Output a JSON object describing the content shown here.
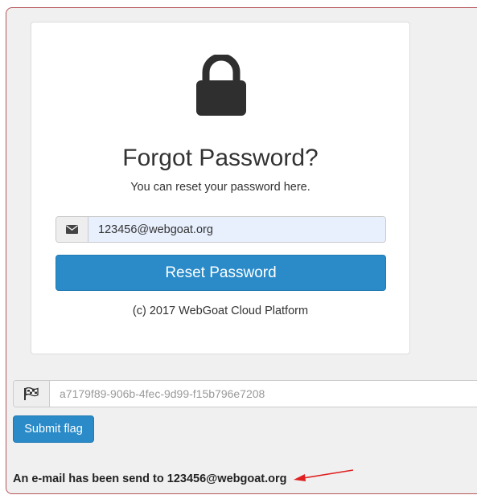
{
  "forgot": {
    "title": "Forgot Password?",
    "subtitle": "You can reset your password here.",
    "email_value": "123456@webgoat.org",
    "reset_label": "Reset Password",
    "copyright": "(c) 2017 WebGoat Cloud Platform"
  },
  "flag": {
    "placeholder": "a7179f89-906b-4fec-9d99-f15b796e7208",
    "submit_label": "Submit flag"
  },
  "result_message": "An e-mail has been send to 123456@webgoat.org",
  "colors": {
    "primary": "#2a8bc8",
    "frame_border": "#b5555a",
    "annotation_arrow": "#e02020"
  },
  "icons": [
    "lock-icon",
    "envelope-icon",
    "flag-icon",
    "arrow-annotation"
  ]
}
